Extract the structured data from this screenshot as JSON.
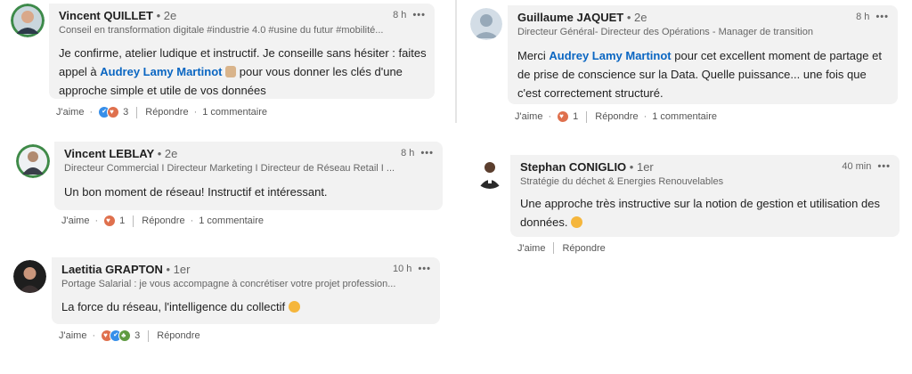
{
  "comments": [
    {
      "name": "Vincent QUILLET",
      "degree": "• 2e",
      "headline": "Conseil en transformation digitale #industrie 4.0 #usine du futur #mobilité...",
      "time": "8 h",
      "text_before": "Je confirme, atelier ludique et instructif. Je conseille sans hésiter : faites appel à ",
      "mention": "Audrey Lamy Martinot",
      "text_after": " pour vous donner les clés d'une approche simple et utile de vos données",
      "like": "J'aime",
      "reaction_count": "3",
      "reply": "Répondre",
      "replies": "1 commentaire"
    },
    {
      "name": "Guillaume JAQUET",
      "degree": "• 2e",
      "headline": "Directeur Général- Directeur des Opérations - Manager de transition",
      "time": "8 h",
      "text_before": "Merci ",
      "mention": "Audrey Lamy Martinot",
      "text_after": " pour cet excellent moment de partage et de prise de conscience sur la Data. Quelle puissance... une fois que c'est correctement structuré.",
      "like": "J'aime",
      "reaction_count": "1",
      "reply": "Répondre",
      "replies": "1 commentaire"
    },
    {
      "name": "Vincent LEBLAY",
      "degree": "• 2e",
      "headline": "Directeur Commercial I Directeur Marketing I Directeur de Réseau Retail I ...",
      "time": "8 h",
      "text": "Un bon moment de réseau! Instructif et intéressant.",
      "like": "J'aime",
      "reaction_count": "1",
      "reply": "Répondre",
      "replies": "1 commentaire"
    },
    {
      "name": "Stephan CONIGLIO",
      "degree": "• 1er",
      "headline": "Stratégie du déchet & Energies Renouvelables",
      "time": "40 min",
      "text": "Une approche très instructive sur la notion de gestion et utilisation des données.",
      "like": "J'aime",
      "reply": "Répondre"
    },
    {
      "name": "Laetitia GRAPTON",
      "degree": "• 1er",
      "headline": "Portage Salarial : je vous accompagne à concrétiser votre projet profession...",
      "time": "10 h",
      "text": "La force du réseau, l'intelligence du collectif",
      "like": "J'aime",
      "reaction_count": "3",
      "reply": "Répondre"
    }
  ],
  "colors": {
    "bubble": "#f2f2f2",
    "mention": "#0a66c2",
    "heart_reaction": "#df704d",
    "like_reaction": "#378fe9",
    "support_reaction": "#5f9b41"
  },
  "icons": [
    "more-options-icon",
    "heart-reaction-icon",
    "like-reaction-icon",
    "support-reaction-icon",
    "smile-emoji-icon",
    "person-emoji-icon"
  ]
}
